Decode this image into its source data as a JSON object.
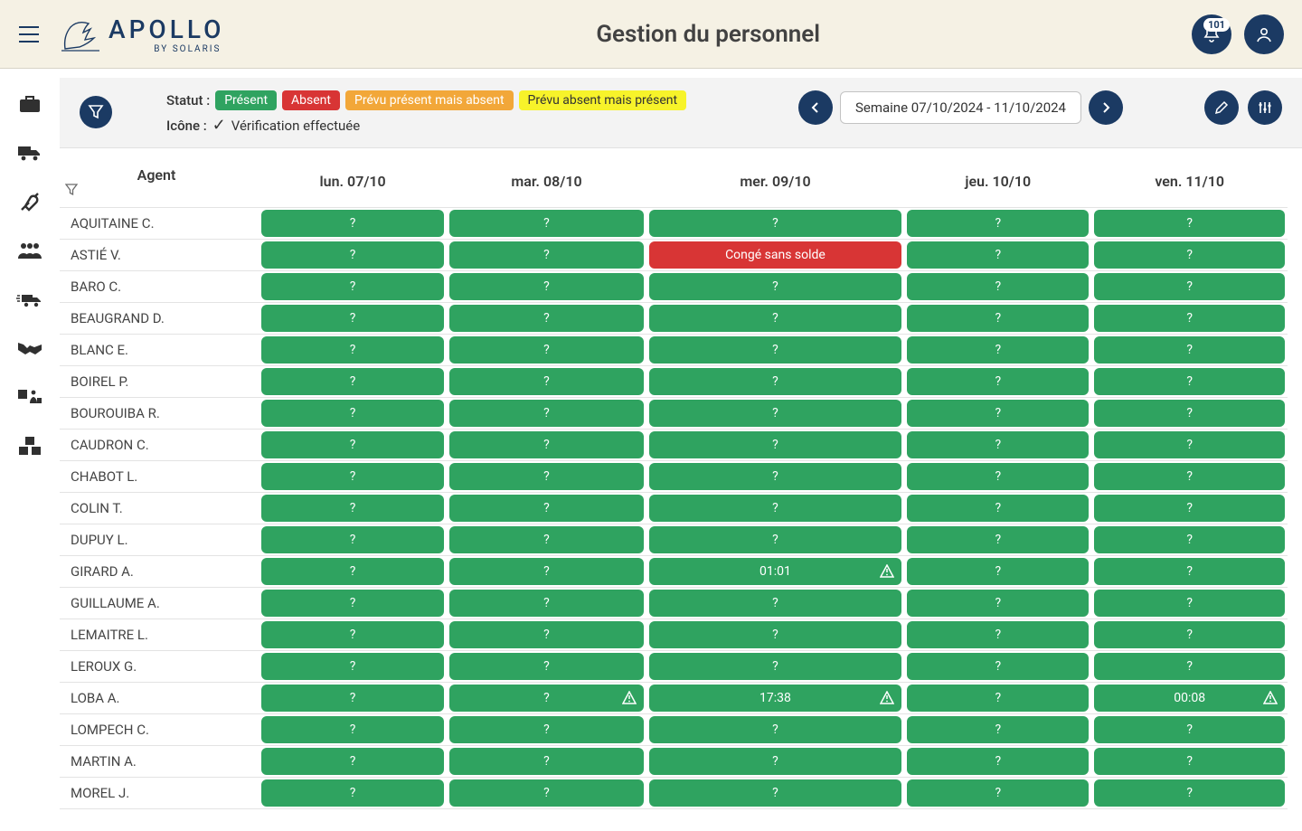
{
  "header": {
    "brand_main": "APOLLO",
    "brand_sub": "BY SOLARIS",
    "title": "Gestion du personnel",
    "notif_count": "101"
  },
  "legend": {
    "status_label": "Statut :",
    "present": "Présent",
    "absent": "Absent",
    "planned_present_absent": "Prévu présent mais absent",
    "planned_absent_present": "Prévu absent mais présent",
    "icon_label": "Icône :",
    "verified": "Vérification effectuée"
  },
  "week": {
    "range": "Semaine 07/10/2024 - 11/10/2024"
  },
  "columns": {
    "agent": "Agent",
    "days": [
      "lun. 07/10",
      "mar. 08/10",
      "mer. 09/10",
      "jeu. 10/10",
      "ven. 11/10"
    ]
  },
  "agents": [
    {
      "name": "AQUITAINE C.",
      "cells": [
        {
          "txt": "?",
          "cls": "st-green"
        },
        {
          "txt": "?",
          "cls": "st-green"
        },
        {
          "txt": "?",
          "cls": "st-green"
        },
        {
          "txt": "?",
          "cls": "st-green"
        },
        {
          "txt": "?",
          "cls": "st-green"
        }
      ]
    },
    {
      "name": "ASTIÉ V.",
      "cells": [
        {
          "txt": "?",
          "cls": "st-green"
        },
        {
          "txt": "?",
          "cls": "st-green"
        },
        {
          "txt": "Congé sans solde",
          "cls": "st-red"
        },
        {
          "txt": "?",
          "cls": "st-green"
        },
        {
          "txt": "?",
          "cls": "st-green"
        }
      ]
    },
    {
      "name": "BARO C.",
      "cells": [
        {
          "txt": "?",
          "cls": "st-green"
        },
        {
          "txt": "?",
          "cls": "st-green"
        },
        {
          "txt": "?",
          "cls": "st-green"
        },
        {
          "txt": "?",
          "cls": "st-green"
        },
        {
          "txt": "?",
          "cls": "st-green"
        }
      ]
    },
    {
      "name": "BEAUGRAND D.",
      "cells": [
        {
          "txt": "?",
          "cls": "st-green"
        },
        {
          "txt": "?",
          "cls": "st-green"
        },
        {
          "txt": "?",
          "cls": "st-green"
        },
        {
          "txt": "?",
          "cls": "st-green"
        },
        {
          "txt": "?",
          "cls": "st-green"
        }
      ]
    },
    {
      "name": "BLANC E.",
      "cells": [
        {
          "txt": "?",
          "cls": "st-green"
        },
        {
          "txt": "?",
          "cls": "st-green"
        },
        {
          "txt": "?",
          "cls": "st-green"
        },
        {
          "txt": "?",
          "cls": "st-green"
        },
        {
          "txt": "?",
          "cls": "st-green"
        }
      ]
    },
    {
      "name": "BOIREL P.",
      "cells": [
        {
          "txt": "?",
          "cls": "st-green"
        },
        {
          "txt": "?",
          "cls": "st-green"
        },
        {
          "txt": "?",
          "cls": "st-green"
        },
        {
          "txt": "?",
          "cls": "st-green"
        },
        {
          "txt": "?",
          "cls": "st-green"
        }
      ]
    },
    {
      "name": "BOUROUIBA R.",
      "cells": [
        {
          "txt": "?",
          "cls": "st-green"
        },
        {
          "txt": "?",
          "cls": "st-green"
        },
        {
          "txt": "?",
          "cls": "st-green"
        },
        {
          "txt": "?",
          "cls": "st-green"
        },
        {
          "txt": "?",
          "cls": "st-green"
        }
      ]
    },
    {
      "name": "CAUDRON C.",
      "cells": [
        {
          "txt": "?",
          "cls": "st-green"
        },
        {
          "txt": "?",
          "cls": "st-green"
        },
        {
          "txt": "?",
          "cls": "st-green"
        },
        {
          "txt": "?",
          "cls": "st-green"
        },
        {
          "txt": "?",
          "cls": "st-green"
        }
      ]
    },
    {
      "name": "CHABOT L.",
      "cells": [
        {
          "txt": "?",
          "cls": "st-green"
        },
        {
          "txt": "?",
          "cls": "st-green"
        },
        {
          "txt": "?",
          "cls": "st-green"
        },
        {
          "txt": "?",
          "cls": "st-green"
        },
        {
          "txt": "?",
          "cls": "st-green"
        }
      ]
    },
    {
      "name": "COLIN T.",
      "cells": [
        {
          "txt": "?",
          "cls": "st-green"
        },
        {
          "txt": "?",
          "cls": "st-green"
        },
        {
          "txt": "?",
          "cls": "st-green"
        },
        {
          "txt": "?",
          "cls": "st-green"
        },
        {
          "txt": "?",
          "cls": "st-green"
        }
      ]
    },
    {
      "name": "DUPUY L.",
      "cells": [
        {
          "txt": "?",
          "cls": "st-green"
        },
        {
          "txt": "?",
          "cls": "st-green"
        },
        {
          "txt": "?",
          "cls": "st-green"
        },
        {
          "txt": "?",
          "cls": "st-green"
        },
        {
          "txt": "?",
          "cls": "st-green"
        }
      ]
    },
    {
      "name": "GIRARD A.",
      "cells": [
        {
          "txt": "?",
          "cls": "st-green"
        },
        {
          "txt": "?",
          "cls": "st-green"
        },
        {
          "txt": "01:01",
          "cls": "st-green",
          "warn": true
        },
        {
          "txt": "?",
          "cls": "st-green"
        },
        {
          "txt": "?",
          "cls": "st-green"
        }
      ]
    },
    {
      "name": "GUILLAUME A.",
      "cells": [
        {
          "txt": "?",
          "cls": "st-green"
        },
        {
          "txt": "?",
          "cls": "st-green"
        },
        {
          "txt": "?",
          "cls": "st-green"
        },
        {
          "txt": "?",
          "cls": "st-green"
        },
        {
          "txt": "?",
          "cls": "st-green"
        }
      ]
    },
    {
      "name": "LEMAITRE L.",
      "cells": [
        {
          "txt": "?",
          "cls": "st-green"
        },
        {
          "txt": "?",
          "cls": "st-green"
        },
        {
          "txt": "?",
          "cls": "st-green"
        },
        {
          "txt": "?",
          "cls": "st-green"
        },
        {
          "txt": "?",
          "cls": "st-green"
        }
      ]
    },
    {
      "name": "LEROUX G.",
      "cells": [
        {
          "txt": "?",
          "cls": "st-green"
        },
        {
          "txt": "?",
          "cls": "st-green"
        },
        {
          "txt": "?",
          "cls": "st-green"
        },
        {
          "txt": "?",
          "cls": "st-green"
        },
        {
          "txt": "?",
          "cls": "st-green"
        }
      ]
    },
    {
      "name": "LOBA A.",
      "cells": [
        {
          "txt": "?",
          "cls": "st-green"
        },
        {
          "txt": "?",
          "cls": "st-green",
          "warn": true
        },
        {
          "txt": "17:38",
          "cls": "st-green",
          "warn": true
        },
        {
          "txt": "?",
          "cls": "st-green"
        },
        {
          "txt": "00:08",
          "cls": "st-green",
          "warn": true
        }
      ]
    },
    {
      "name": "LOMPECH C.",
      "cells": [
        {
          "txt": "?",
          "cls": "st-green"
        },
        {
          "txt": "?",
          "cls": "st-green"
        },
        {
          "txt": "?",
          "cls": "st-green"
        },
        {
          "txt": "?",
          "cls": "st-green"
        },
        {
          "txt": "?",
          "cls": "st-green"
        }
      ]
    },
    {
      "name": "MARTIN A.",
      "cells": [
        {
          "txt": "?",
          "cls": "st-green"
        },
        {
          "txt": "?",
          "cls": "st-green"
        },
        {
          "txt": "?",
          "cls": "st-green"
        },
        {
          "txt": "?",
          "cls": "st-green"
        },
        {
          "txt": "?",
          "cls": "st-green"
        }
      ]
    },
    {
      "name": "MOREL J.",
      "cells": [
        {
          "txt": "?",
          "cls": "st-green"
        },
        {
          "txt": "?",
          "cls": "st-green"
        },
        {
          "txt": "?",
          "cls": "st-green"
        },
        {
          "txt": "?",
          "cls": "st-green"
        },
        {
          "txt": "?",
          "cls": "st-green"
        }
      ]
    }
  ]
}
